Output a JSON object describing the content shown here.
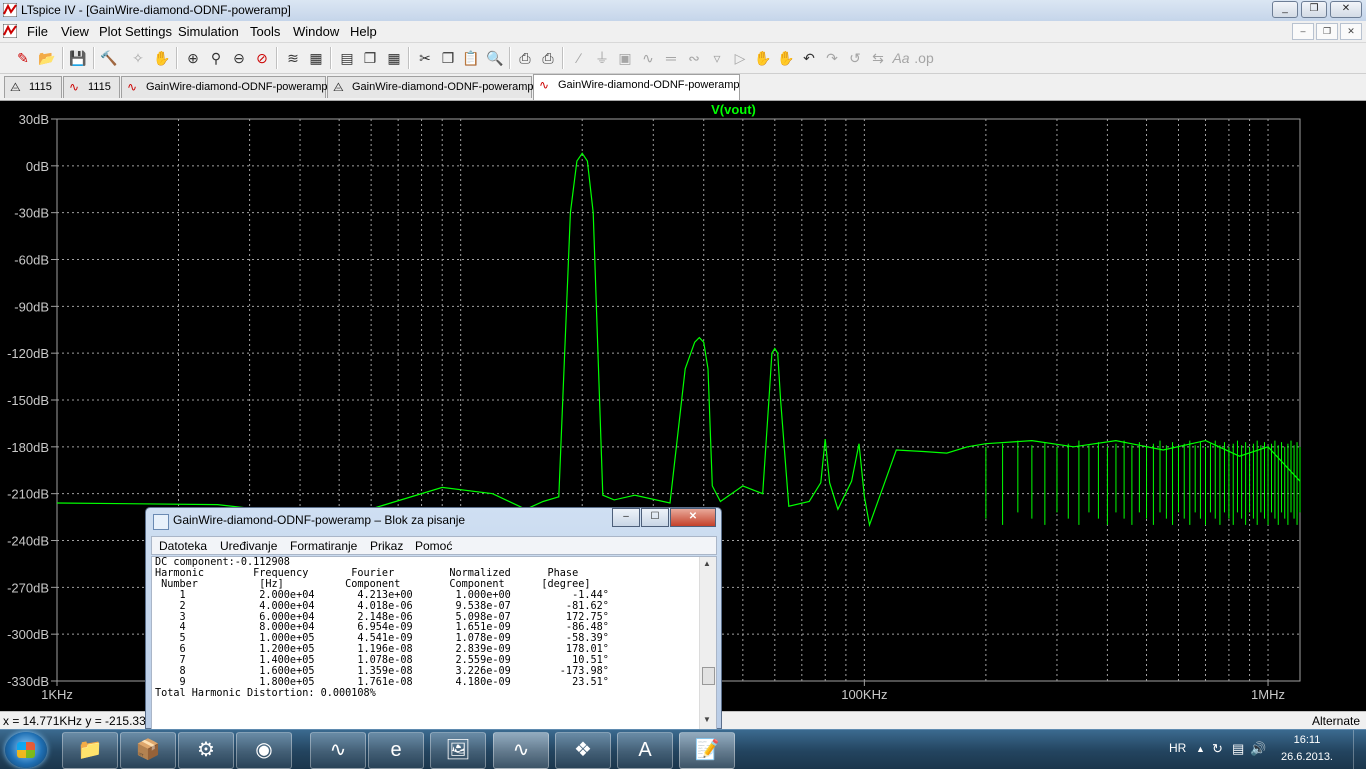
{
  "window": {
    "title": "LTspice IV - [GainWire-diamond-ODNF-poweramp]",
    "buttons": [
      "_",
      "❐",
      "✕"
    ]
  },
  "menu": {
    "items": [
      "File",
      "View",
      "Plot Settings",
      "Simulation",
      "Tools",
      "Window",
      "Help"
    ]
  },
  "tabs": [
    {
      "label": "1115",
      "icon": "schematic-icon"
    },
    {
      "label": "1115",
      "icon": "waveform-icon"
    },
    {
      "label": "GainWire-diamond-ODNF-poweramp",
      "icon": "waveform-icon"
    },
    {
      "label": "GainWire-diamond-ODNF-poweramp",
      "icon": "schematic-icon"
    },
    {
      "label": "GainWire-diamond-ODNF-poweramp",
      "icon": "waveform-icon"
    }
  ],
  "plot": {
    "trace_label": "V(vout)",
    "trace_color": "#00ff00",
    "grid_color": "#a0a0a0"
  },
  "chart_data": {
    "type": "line",
    "title": "V(vout)",
    "x_scale": "log",
    "xlim": [
      1000,
      1200000
    ],
    "ylim": [
      -330,
      30
    ],
    "grid": true,
    "y_ticks": [
      "30dB",
      "0dB",
      "-30dB",
      "-60dB",
      "-90dB",
      "-120dB",
      "-150dB",
      "-180dB",
      "-210dB",
      "-240dB",
      "-270dB",
      "-300dB",
      "-330dB"
    ],
    "x_ticks": [
      "1KHz",
      "100KHz",
      "1MHz"
    ],
    "series": [
      {
        "name": "V(vout)",
        "x": [
          1000,
          2500,
          5000,
          9000,
          12000,
          14500,
          16000,
          17500,
          18700,
          19400,
          20000,
          20600,
          21300,
          22500,
          24000,
          27000,
          33000,
          36000,
          38000,
          39000,
          40000,
          41000,
          42000,
          44000,
          50000,
          56000,
          58000,
          59000,
          60000,
          61000,
          62000,
          65000,
          73000,
          78000,
          80000,
          82000,
          86000,
          93000,
          97000,
          100000,
          103000,
          120000,
          140000,
          160000,
          180000,
          200000,
          260000,
          330000,
          420000,
          550000,
          700000,
          850000,
          1000000,
          1200000
        ],
        "y": [
          -216,
          -217,
          -226,
          -206,
          -210,
          -220,
          -215,
          -212,
          -30,
          3,
          8,
          3,
          -30,
          -211,
          -214,
          -211,
          -216,
          -130,
          -113,
          -110,
          -113,
          -130,
          -205,
          -215,
          -205,
          -210,
          -150,
          -120,
          -117,
          -120,
          -150,
          -218,
          -215,
          -203,
          -175,
          -203,
          -220,
          -202,
          -178,
          -212,
          -230,
          -182,
          -183,
          -184,
          -180,
          -178,
          -176,
          -180,
          -176,
          -182,
          -176,
          -186,
          -180,
          -202
        ]
      }
    ]
  },
  "status": {
    "cursor": "x = 14.771KHz   y = -215.33dB",
    "mode": "Alternate"
  },
  "notepad": {
    "title": "GainWire-diamond-ODNF-poweramp – Blok za pisanje",
    "menu": [
      "Datoteka",
      "Uređivanje",
      "Formatiranje",
      "Prikaz",
      "Pomoć"
    ],
    "dc_line": "DC component:-0.112908",
    "header1": "Harmonic        Frequency       Fourier         Normalized      Phase",
    "header2": " Number          [Hz]          Component        Component      [degree]",
    "rows": [
      "    1            2.000e+04       4.213e+00       1.000e+00          -1.44°",
      "    2            4.000e+04       4.018e-06       9.538e-07         -81.62°",
      "    3            6.000e+04       2.148e-06       5.098e-07         172.75°",
      "    4            8.000e+04       6.954e-09       1.651e-09         -86.48°",
      "    5            1.000e+05       4.541e-09       1.078e-09         -58.39°",
      "    6            1.200e+05       1.196e-08       2.839e-09         178.01°",
      "    7            1.400e+05       1.078e-08       2.559e-09          10.51°",
      "    8            1.600e+05       1.359e-08       3.226e-09        -173.98°",
      "    9            1.800e+05       1.761e-08       4.180e-09          23.51°"
    ],
    "thd_line": "Total Harmonic Distortion: 0.000108%"
  },
  "taskbar": {
    "apps": [
      "explorer-icon",
      "package-icon",
      "cad-icon",
      "lifebuoy-icon",
      "oscilloscope-icon",
      "internet-explorer-icon",
      "photo-viewer-icon",
      "ltspice-icon",
      "pdf-icon",
      "document-icon",
      "notepad-icon"
    ],
    "language": "HR",
    "time": "16:11",
    "date": "26.6.2013."
  }
}
